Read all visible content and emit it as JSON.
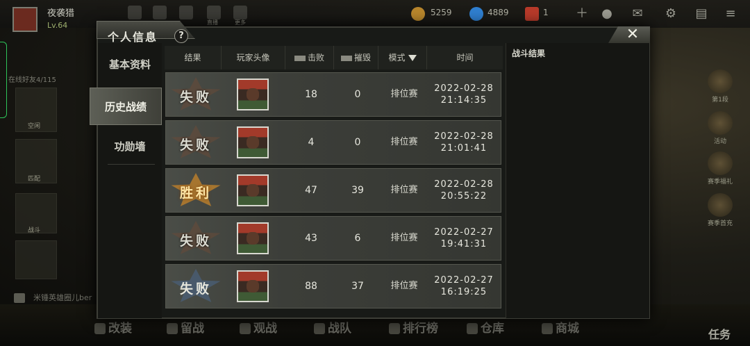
{
  "player": {
    "name": "夜袭猎",
    "level": "Lv.64"
  },
  "top_nav": [
    {
      "icon": "home-icon",
      "label": ""
    },
    {
      "icon": "crown-icon",
      "label": ""
    },
    {
      "icon": "wechat-icon",
      "label": ""
    },
    {
      "icon": "play-icon",
      "label": "直播"
    },
    {
      "icon": "qrcode-icon",
      "label": "更多"
    }
  ],
  "currency": {
    "gold": "5259",
    "diamond": "4889",
    "ticket": "1"
  },
  "friends_online": "在线好友4/115",
  "modal": {
    "title": "个人信息",
    "help": "?",
    "close": "✕",
    "menu": [
      "基本资料",
      "历史战绩",
      "功勋墙"
    ],
    "active_menu": 1,
    "headers": {
      "result": "结果",
      "avatar": "玩家头像",
      "kills": "击败",
      "destroyed": "摧毁",
      "mode": "模式",
      "time": "时间"
    },
    "detail_title": "战斗结果",
    "rows": [
      {
        "result": "失败",
        "kills": "18",
        "destroyed": "0",
        "mode": "排位赛",
        "date": "2022-02-28",
        "time": "21:14:35"
      },
      {
        "result": "失败",
        "kills": "4",
        "destroyed": "0",
        "mode": "排位赛",
        "date": "2022-02-28",
        "time": "21:01:41"
      },
      {
        "result": "胜利",
        "kills": "47",
        "destroyed": "39",
        "mode": "排位赛",
        "date": "2022-02-28",
        "time": "20:55:22"
      },
      {
        "result": "失败",
        "kills": "43",
        "destroyed": "6",
        "mode": "排位赛",
        "date": "2022-02-27",
        "time": "19:41:31"
      },
      {
        "result": "失败",
        "kills": "88",
        "destroyed": "37",
        "mode": "排位赛",
        "date": "2022-02-27",
        "time": "16:19:25"
      }
    ]
  },
  "left_side": {
    "card1": "空闲",
    "card2": "匹配",
    "card3": "战斗"
  },
  "right_side": [
    "第1段",
    "活动",
    "赛季福礼",
    "赛季首充"
  ],
  "bottom_nav": [
    "改装",
    "留战",
    "观战",
    "战队",
    "排行榜",
    "仓库",
    "商城"
  ],
  "mission": "任务",
  "chat": "米锤英雄圈儿ber"
}
